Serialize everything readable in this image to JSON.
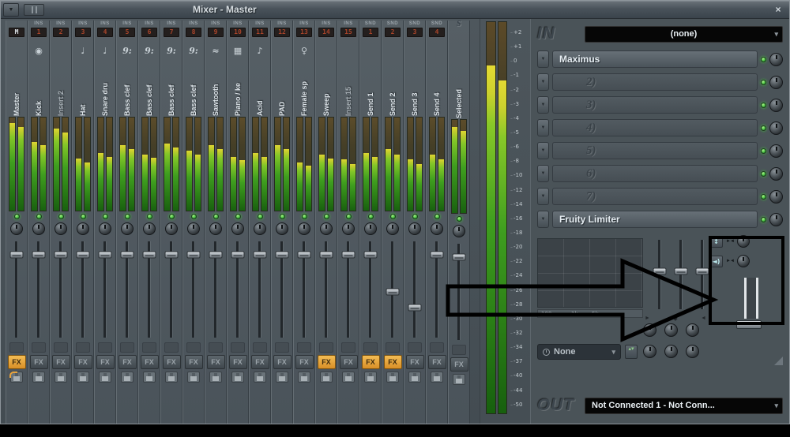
{
  "window": {
    "title": "Mixer - Master"
  },
  "labels": {
    "fx": "FX"
  },
  "icons": {
    "close": "×",
    "menu_arrow": "▼",
    "dropdown_arrow": "▾",
    "slot_arrow": "▼",
    "stereo_swap": "↕",
    "speaker": "◄)",
    "link_arrows": "►◄",
    "updown": "▴▾",
    "swap_left": "►",
    "swap_mid": "◆",
    "swap_right": "◄"
  },
  "colors": {
    "fx_active": "#e8a33c",
    "led_green": "#4ad03e",
    "meter_green": "#3f9e1f"
  },
  "mixer": {
    "master_meter": [
      89,
      85
    ],
    "db_scale": [
      "+2",
      "+1",
      "0",
      "-1",
      "-2",
      "-3",
      "-4",
      "-5",
      "-6",
      "-8",
      "-10",
      "-12",
      "-14",
      "-16",
      "-18",
      "-20",
      "-22",
      "-24",
      "-26",
      "-28",
      "-30",
      "-32",
      "-34",
      "-37",
      "-40",
      "-44",
      "-50"
    ],
    "strips": [
      {
        "type": "",
        "num": "M",
        "num_white": true,
        "label": "Master",
        "icon": "",
        "meters": [
          94,
          90
        ],
        "fader": 16,
        "fx_on": true
      },
      {
        "type": "INS",
        "num": "1",
        "label": "Kick",
        "icon": "◉",
        "meters": [
          74,
          70
        ],
        "fader": 16,
        "fx_on": false
      },
      {
        "type": "INS",
        "num": "2",
        "label": "Insert 2",
        "dim": true,
        "icon": "",
        "meters": [
          88,
          84
        ],
        "fader": 16,
        "fx_on": false
      },
      {
        "type": "INS",
        "num": "3",
        "label": "Hat",
        "icon": "♩",
        "meters": [
          56,
          52
        ],
        "fader": 16,
        "fx_on": false
      },
      {
        "type": "INS",
        "num": "4",
        "label": "Snare dru",
        "icon": "♩",
        "meters": [
          62,
          58
        ],
        "fader": 16,
        "fx_on": false
      },
      {
        "type": "INS",
        "num": "5",
        "label": "Bass clef",
        "icon": "9:",
        "meters": [
          70,
          66
        ],
        "fader": 16,
        "fx_on": false
      },
      {
        "type": "INS",
        "num": "6",
        "label": "Bass clef",
        "icon": "9:",
        "meters": [
          60,
          57
        ],
        "fader": 16,
        "fx_on": false
      },
      {
        "type": "INS",
        "num": "7",
        "label": "Bass clef",
        "icon": "9:",
        "meters": [
          72,
          68
        ],
        "fader": 16,
        "fx_on": false
      },
      {
        "type": "INS",
        "num": "8",
        "label": "Bass clef",
        "icon": "9:",
        "meters": [
          64,
          60
        ],
        "fader": 16,
        "fx_on": false
      },
      {
        "type": "INS",
        "num": "9",
        "label": "Sawtooth",
        "icon": "≈",
        "meters": [
          70,
          66
        ],
        "fader": 16,
        "fx_on": false
      },
      {
        "type": "INS",
        "num": "10",
        "label": "Piano / ke",
        "icon": "▦",
        "meters": [
          58,
          54
        ],
        "fader": 16,
        "fx_on": false
      },
      {
        "type": "INS",
        "num": "11",
        "label": "Acid",
        "icon": "♪",
        "meters": [
          62,
          58
        ],
        "fader": 16,
        "fx_on": false
      },
      {
        "type": "INS",
        "num": "12",
        "label": "PAD",
        "icon": "",
        "meters": [
          70,
          66
        ],
        "fader": 16,
        "fx_on": false
      },
      {
        "type": "INS",
        "num": "13",
        "label": "Female sp",
        "icon": "♀",
        "meters": [
          52,
          48
        ],
        "fader": 16,
        "fx_on": false
      },
      {
        "type": "INS",
        "num": "14",
        "label": "Sweep",
        "icon": "",
        "meters": [
          60,
          56
        ],
        "fader": 16,
        "fx_on": true
      },
      {
        "type": "INS",
        "num": "15",
        "label": "Insert 15",
        "dim": true,
        "icon": "",
        "meters": [
          55,
          50
        ],
        "fader": 16,
        "fx_on": false
      },
      {
        "type": "SND",
        "num": "1",
        "label": "Send 1",
        "icon": "",
        "meters": [
          62,
          58
        ],
        "fader": 16,
        "fx_on": true
      },
      {
        "type": "SND",
        "num": "2",
        "label": "Send 2",
        "icon": "",
        "meters": [
          66,
          60
        ],
        "fader": 52,
        "fx_on": true
      },
      {
        "type": "SND",
        "num": "3",
        "label": "Send 3",
        "icon": "",
        "meters": [
          55,
          50
        ],
        "fader": 68,
        "fx_on": false
      },
      {
        "type": "SND",
        "num": "4",
        "label": "Send 4",
        "icon": "",
        "meters": [
          60,
          55
        ],
        "fader": 16,
        "fx_on": false
      },
      {
        "type": "S",
        "num": "",
        "label": "Selected",
        "icon": "",
        "meters": [
          92,
          88
        ],
        "fader": 16,
        "fx_on": false
      }
    ]
  },
  "effects": {
    "in_title": "IN",
    "in_value": "(none)",
    "slots": [
      {
        "name": "Maximus",
        "filled": true
      },
      {
        "name": "2)",
        "filled": false
      },
      {
        "name": "3)",
        "filled": false
      },
      {
        "name": "4)",
        "filled": false
      },
      {
        "name": "5)",
        "filled": false
      },
      {
        "name": "6)",
        "filled": false
      },
      {
        "name": "7)",
        "filled": false
      },
      {
        "name": "Fruity Limiter",
        "filled": true
      }
    ],
    "freq_labels": [
      "100",
      "1k",
      "5k"
    ],
    "preset_value": "None",
    "out_title": "OUT",
    "out_value": "Not Connected 1 - Not Conn..."
  }
}
